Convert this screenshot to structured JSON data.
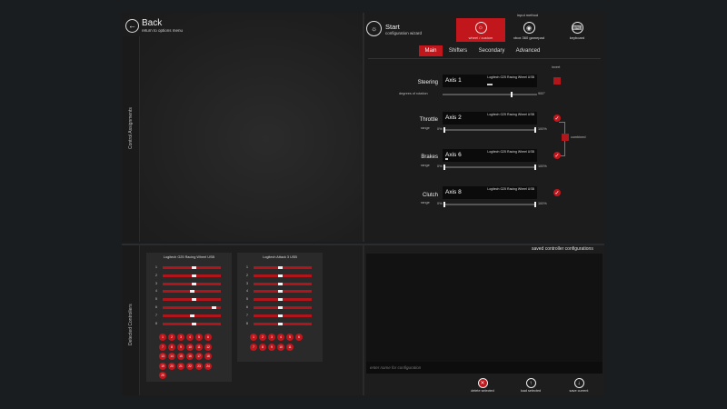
{
  "header": {
    "back_title": "Back",
    "back_sub": "return to options menu",
    "start_title": "Start",
    "start_sub": "configuration wizard"
  },
  "input_method": {
    "label": "input method",
    "options": [
      {
        "label": "wheel / custom",
        "icon": "steering-wheel-icon",
        "selected": true
      },
      {
        "label": "xbox 360 gamepad",
        "icon": "gamepad-icon",
        "selected": false
      },
      {
        "label": "keyboard",
        "icon": "keyboard-icon",
        "selected": false
      }
    ]
  },
  "tabs": [
    {
      "label": "Main",
      "active": true
    },
    {
      "label": "Shifters",
      "active": false
    },
    {
      "label": "Secondary",
      "active": false
    },
    {
      "label": "Advanced",
      "active": false
    }
  ],
  "axes": {
    "invert_label": "invert",
    "combined_label": "combined",
    "steering": {
      "name": "Steering",
      "axis": "Axis 1",
      "device": "Logitech G25 Racing Wheel USB",
      "rotation_label": "degrees of rotation",
      "rotation_value": "900°"
    },
    "throttle": {
      "name": "Throttle",
      "axis": "Axis 2",
      "device": "Logitech G25 Racing Wheel USB",
      "range_label": "range",
      "range_min": "0%",
      "range_max": "100%"
    },
    "brakes": {
      "name": "Brakes",
      "axis": "Axis 6",
      "device": "Logitech G25 Racing Wheel USB",
      "range_label": "range",
      "range_min": "0%",
      "range_max": "100%"
    },
    "clutch": {
      "name": "Clutch",
      "axis": "Axis 8",
      "device": "Logitech G25 Racing Wheel USB",
      "range_label": "range",
      "range_min": "0%",
      "range_max": "100%"
    }
  },
  "side_labels": {
    "control_assignments": "Control Assignments",
    "detected_controllers": "Detected Controllers"
  },
  "controllers": [
    {
      "name": "Logitech G25 Racing Wheel USB",
      "axes": [
        "1",
        "2",
        "3",
        "4",
        "5",
        "6",
        "7",
        "8"
      ],
      "buttons": [
        "1",
        "2",
        "3",
        "4",
        "5",
        "6",
        "7",
        "8",
        "9",
        "10",
        "11",
        "12",
        "13",
        "14",
        "15",
        "16",
        "17",
        "18",
        "19",
        "20",
        "21",
        "22",
        "23",
        "24",
        "25"
      ]
    },
    {
      "name": "Logitech Attack 3 USB",
      "axes": [
        "1",
        "2",
        "3",
        "4",
        "5",
        "6",
        "7",
        "8"
      ],
      "buttons": [
        "1",
        "2",
        "3",
        "4",
        "5",
        "6",
        "7",
        "8",
        "9",
        "10",
        "11"
      ]
    }
  ],
  "configurations": {
    "title": "saved controller configurations",
    "input_placeholder": "enter name for configuration",
    "buttons": [
      {
        "label": "delete selected",
        "icon": "delete-icon"
      },
      {
        "label": "load selected",
        "icon": "load-icon"
      },
      {
        "label": "save current",
        "icon": "save-icon"
      }
    ]
  }
}
